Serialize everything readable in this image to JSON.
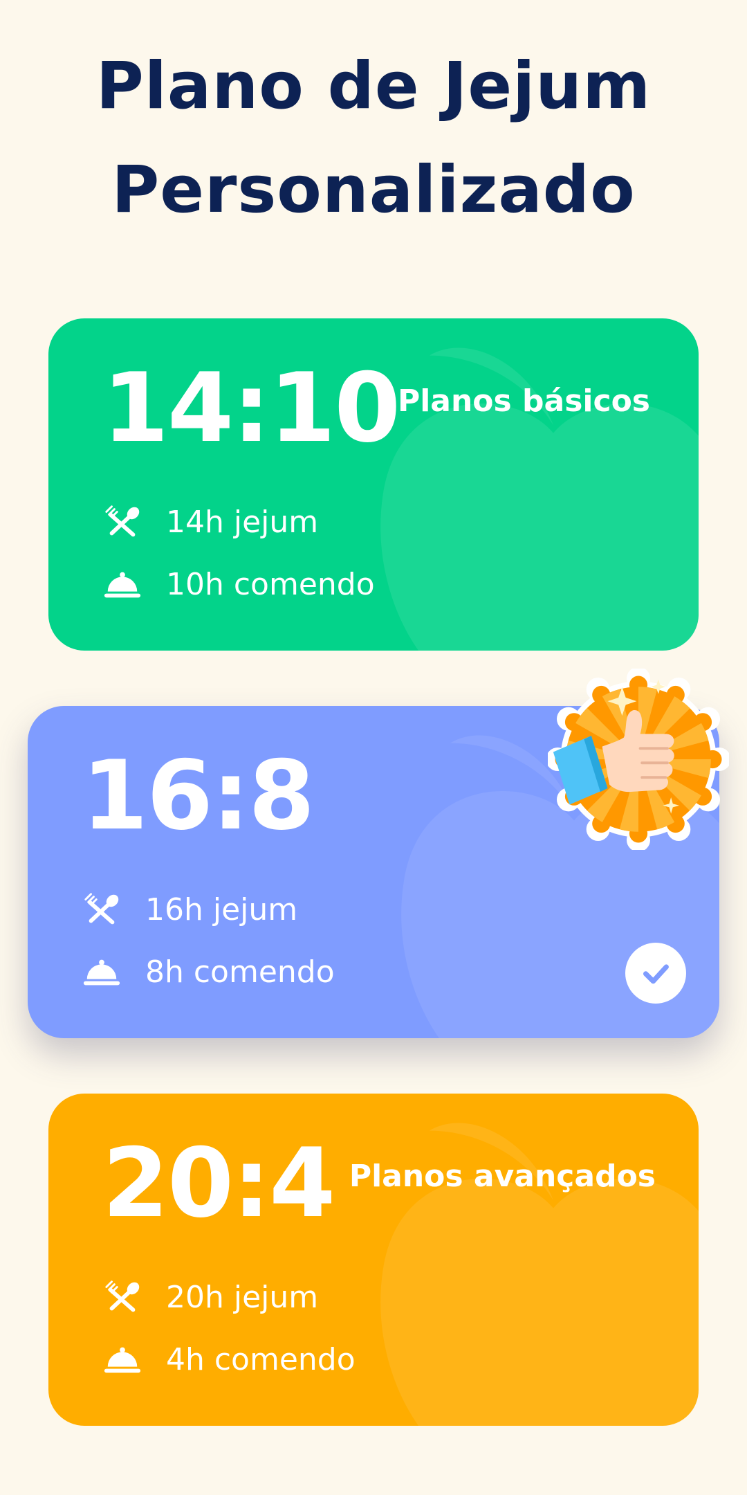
{
  "header": {
    "title_line_1": "Plano de Jejum",
    "title_line_2": "Personalizado"
  },
  "plans": [
    {
      "ratio": "14:10",
      "tier": "Planos básicos",
      "fasting": "14h jejum",
      "eating": "10h comendo",
      "color": "#03d38a",
      "selected": false
    },
    {
      "ratio": "16:8",
      "tier": "",
      "fasting": "16h jejum",
      "eating": "8h comendo",
      "color": "#7f9cff",
      "selected": true,
      "badge_icon": "thumbs-up-badge-icon"
    },
    {
      "ratio": "20:4",
      "tier": "Planos avançados",
      "fasting": "20h jejum",
      "eating": "4h comendo",
      "color": "#ffad00",
      "selected": false
    }
  ],
  "icons": {
    "fasting": "fork-spoon-icon",
    "eating": "food-cloche-icon",
    "selected": "checkmark-icon",
    "decoration": "apple-icon"
  },
  "colors": {
    "background": "#fdf8ec",
    "title": "#0d2254",
    "basic": "#03d38a",
    "recommended": "#7f9cff",
    "advanced": "#ffad00"
  }
}
